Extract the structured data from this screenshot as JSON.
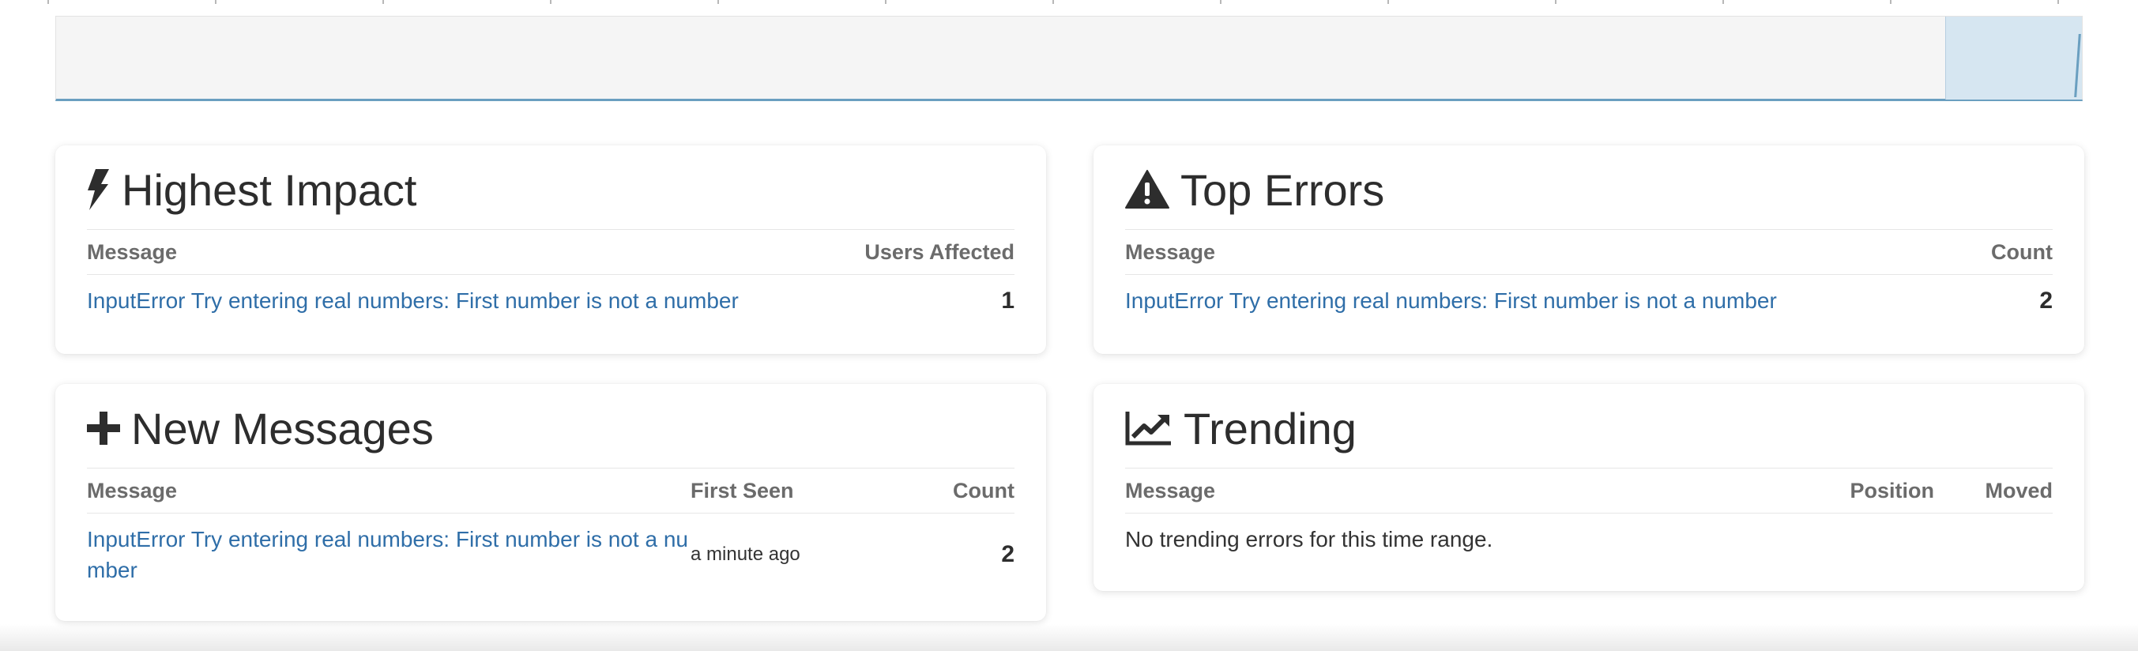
{
  "highest_impact": {
    "title": "Highest Impact",
    "icon": "bolt-icon",
    "columns": {
      "message": "Message",
      "users": "Users Affected"
    },
    "rows": [
      {
        "message": "InputError Try entering real numbers: First number is not a number",
        "users": "1"
      }
    ]
  },
  "top_errors": {
    "title": "Top Errors",
    "icon": "warning-icon",
    "columns": {
      "message": "Message",
      "count": "Count"
    },
    "rows": [
      {
        "message": "InputError Try entering real numbers: First number is not a number",
        "count": "2"
      }
    ]
  },
  "new_messages": {
    "title": "New Messages",
    "icon": "plus-icon",
    "columns": {
      "message": "Message",
      "first_seen": "First Seen",
      "count": "Count"
    },
    "rows": [
      {
        "message_line1": "InputError Try entering real numbers: First number is not a nu",
        "message_line2": "mber",
        "first_seen": "a minute ago",
        "count": "2"
      }
    ]
  },
  "trending": {
    "title": "Trending",
    "icon": "line-chart-icon",
    "columns": {
      "message": "Message",
      "position": "Position",
      "moved": "Moved"
    },
    "empty_text": "No trending errors for this time range."
  },
  "colors": {
    "link": "#2f6ea8",
    "range_accent": "#6a9fc0",
    "range_selection": "#d6e6f1"
  }
}
